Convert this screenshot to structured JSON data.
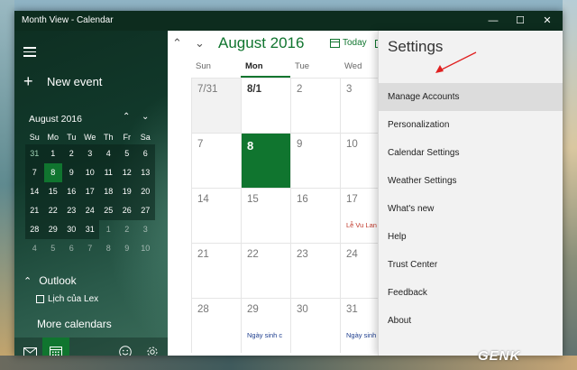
{
  "window": {
    "title": "Month View - Calendar",
    "controls": {
      "minimize": "—",
      "maximize": "☐",
      "close": "✕"
    }
  },
  "sidebar": {
    "new_event": "New event",
    "mini_calendar": {
      "month": "August 2016",
      "dow": [
        "Su",
        "Mo",
        "Tu",
        "We",
        "Th",
        "Fr",
        "Sa"
      ],
      "weeks": [
        [
          "31",
          "1",
          "2",
          "3",
          "4",
          "5",
          "6"
        ],
        [
          "7",
          "8",
          "9",
          "10",
          "11",
          "12",
          "13"
        ],
        [
          "14",
          "15",
          "16",
          "17",
          "18",
          "19",
          "20"
        ],
        [
          "21",
          "22",
          "23",
          "24",
          "25",
          "26",
          "27"
        ],
        [
          "28",
          "29",
          "30",
          "31",
          "1",
          "2",
          "3"
        ],
        [
          "4",
          "5",
          "6",
          "7",
          "8",
          "9",
          "10"
        ]
      ],
      "today": "8"
    },
    "outlook_label": "Outlook",
    "calendar_item": "Lịch của Lex",
    "more_calendars": "More calendars"
  },
  "main": {
    "month_title": "August 2016",
    "today_label": "Today",
    "dow": [
      "Sun",
      "Mon",
      "Tue",
      "Wed"
    ],
    "active_dow": "Mon",
    "weeks": [
      [
        {
          "n": "7/31",
          "prev": true
        },
        {
          "n": "8/1",
          "bold": true
        },
        {
          "n": "2"
        },
        {
          "n": "3"
        }
      ],
      [
        {
          "n": "7"
        },
        {
          "n": "8",
          "today": true
        },
        {
          "n": "9"
        },
        {
          "n": "10"
        }
      ],
      [
        {
          "n": "14"
        },
        {
          "n": "15"
        },
        {
          "n": "16"
        },
        {
          "n": "17",
          "event": "Lễ Vu Lan",
          "event_color": "red"
        }
      ],
      [
        {
          "n": "21"
        },
        {
          "n": "22"
        },
        {
          "n": "23"
        },
        {
          "n": "24"
        }
      ],
      [
        {
          "n": "28"
        },
        {
          "n": "29",
          "event": "Ngày sinh c",
          "event_color": "blue"
        },
        {
          "n": "30"
        },
        {
          "n": "31",
          "event": "Ngày sinh c",
          "event_color": "blue"
        }
      ]
    ]
  },
  "settings": {
    "title": "Settings",
    "items": [
      "Manage Accounts",
      "Personalization",
      "Calendar Settings",
      "Weather Settings",
      "What's new",
      "Help",
      "Trust Center",
      "Feedback",
      "About"
    ],
    "highlighted": "Manage Accounts"
  },
  "watermark": "GENK",
  "colors": {
    "accent": "#10752f",
    "titlebar": "#0d2c1e",
    "annotation": "#e02020"
  }
}
